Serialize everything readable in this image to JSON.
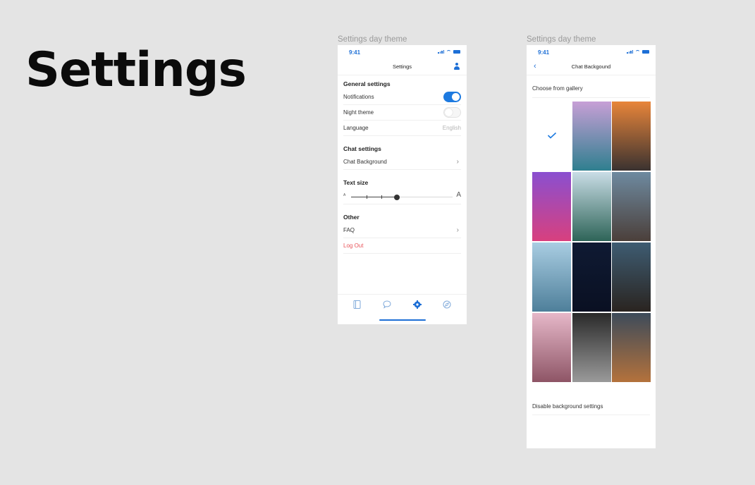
{
  "page": {
    "title": "Settings"
  },
  "settings_screen": {
    "frame_label": "Settings day theme",
    "status": {
      "time": "9:41"
    },
    "nav": {
      "title": "Settings"
    },
    "general": {
      "heading": "General settings",
      "notifications": {
        "label": "Notifications",
        "on": true
      },
      "night_theme": {
        "label": "Night theme",
        "on": false
      },
      "language": {
        "label": "Language",
        "value": "English"
      }
    },
    "chat": {
      "heading": "Chat settings",
      "background": {
        "label": "Chat Background"
      }
    },
    "text_size": {
      "heading": "Text size",
      "small_glyph": "A",
      "large_glyph": "A",
      "level": 0.45
    },
    "other": {
      "heading": "Other",
      "faq": "FAQ",
      "logout": "Log Out"
    },
    "tab_bar": {
      "tabs": [
        {
          "icon": "book-icon",
          "active": false
        },
        {
          "icon": "chat-bubble-icon",
          "active": false
        },
        {
          "icon": "gear-icon",
          "active": true
        },
        {
          "icon": "compass-icon",
          "active": false
        }
      ]
    }
  },
  "background_screen": {
    "frame_label": "Settings day theme",
    "status": {
      "time": "9:41"
    },
    "nav": {
      "title": "Chat Backgound"
    },
    "gallery_label": "Choose from gallery",
    "selected_index": 0,
    "wallpapers": [
      {
        "name": "selected-blank",
        "colors": [
          "#ffffff",
          "#ffffff"
        ]
      },
      {
        "name": "ocean-sunset",
        "colors": [
          "#c79fd6",
          "#2f7f8f"
        ]
      },
      {
        "name": "hill-sunset",
        "colors": [
          "#e8853a",
          "#3a3230"
        ]
      },
      {
        "name": "palm-purple-sky",
        "colors": [
          "#8a4fd0",
          "#d8407e"
        ]
      },
      {
        "name": "mountain-lake",
        "colors": [
          "#c9dde6",
          "#2e6458"
        ]
      },
      {
        "name": "canyon-road",
        "colors": [
          "#6e8aa0",
          "#4b3f3a"
        ]
      },
      {
        "name": "palm-blue-sky",
        "colors": [
          "#a9cde2",
          "#4e7f9a"
        ]
      },
      {
        "name": "night-moon",
        "colors": [
          "#0f1a33",
          "#0a1022"
        ]
      },
      {
        "name": "skyscraper",
        "colors": [
          "#3e5c72",
          "#2a2420"
        ]
      },
      {
        "name": "cherry-blossom",
        "colors": [
          "#e6b8c9",
          "#8e5566"
        ]
      },
      {
        "name": "waterfall",
        "colors": [
          "#2a2a2a",
          "#9a9a9a"
        ]
      },
      {
        "name": "river-delta",
        "colors": [
          "#3d4b5a",
          "#b4723c"
        ]
      }
    ],
    "disable_label": "Disable background settings"
  },
  "colors": {
    "accent": "#1d7ae0",
    "danger": "#e8545a",
    "canvas": "#e4e4e4"
  }
}
